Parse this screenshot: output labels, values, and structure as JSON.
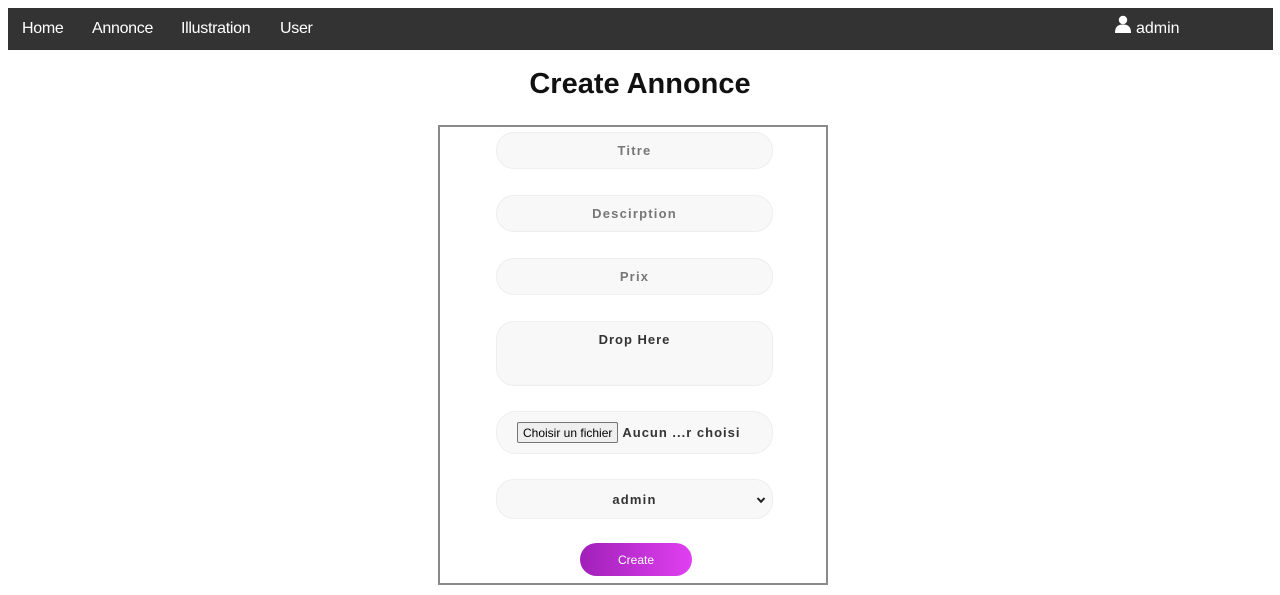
{
  "nav": {
    "items": [
      {
        "label": "Home"
      },
      {
        "label": "Annonce"
      },
      {
        "label": "Illustration"
      },
      {
        "label": "User"
      }
    ],
    "user": {
      "label": "admin",
      "icon": "user-icon"
    }
  },
  "page": {
    "title": "Create Annonce"
  },
  "form": {
    "titre_placeholder": "Titre",
    "titre_value": "",
    "description_placeholder": "Descirption",
    "description_value": "",
    "prix_placeholder": "Prix",
    "prix_value": "",
    "dropzone_label": "Drop Here",
    "file_button_label": "Choisir un fichier",
    "file_status": "Aucun ...r choisi",
    "user_select_value": "admin",
    "submit_label": "Create"
  },
  "colors": {
    "navbar_bg": "#333333",
    "button_gradient_start": "#a020b8",
    "button_gradient_end": "#e040f0"
  }
}
